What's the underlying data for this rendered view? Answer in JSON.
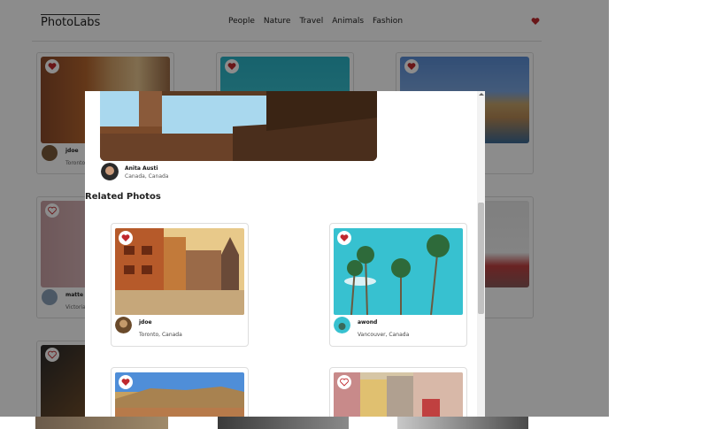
{
  "app": {
    "logo": "PhotoLabs"
  },
  "nav": {
    "topics": [
      "People",
      "Nature",
      "Travel",
      "Animals",
      "Fashion"
    ]
  },
  "background_cards": [
    {
      "name": "jdoe",
      "location": "Toronto"
    },
    {
      "name": "matte",
      "location": "Victoria"
    }
  ],
  "modal": {
    "user": {
      "name": "Anita Austi",
      "location": "Canada, Canada"
    },
    "related_title": "Related Photos",
    "cards": [
      {
        "name": "jdoe",
        "location": "Toronto, Canada",
        "favorited": true
      },
      {
        "name": "awond",
        "location": "Vancouver, Canada",
        "favorited": true
      },
      {
        "name": "",
        "location": "",
        "favorited": true
      },
      {
        "name": "",
        "location": "",
        "favorited": false
      }
    ]
  },
  "colors": {
    "accent": "#c0282d",
    "overlay": "rgba(0,0,0,0.45)"
  }
}
